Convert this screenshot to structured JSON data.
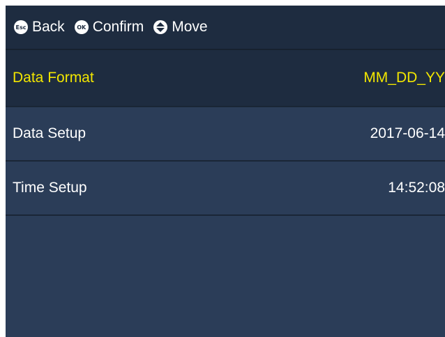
{
  "topbar": {
    "hints": [
      {
        "key": "Esc",
        "icon": "esc-key-icon",
        "label": "Back"
      },
      {
        "key": "OK",
        "icon": "ok-key-icon",
        "label": "Confirm"
      },
      {
        "key": "",
        "icon": "up-down-arrow-icon",
        "label": "Move"
      }
    ]
  },
  "menu": {
    "items": [
      {
        "label": "Data Format",
        "value": "MM_DD_YY",
        "selected": true
      },
      {
        "label": "Data Setup",
        "value": "2017-06-14",
        "selected": false
      },
      {
        "label": "Time Setup",
        "value": "14:52:08",
        "selected": false
      }
    ]
  },
  "colors": {
    "background": "#2b3d58",
    "header": "#1e2c40",
    "selected_text": "#f2e600",
    "text": "#ffffff"
  }
}
